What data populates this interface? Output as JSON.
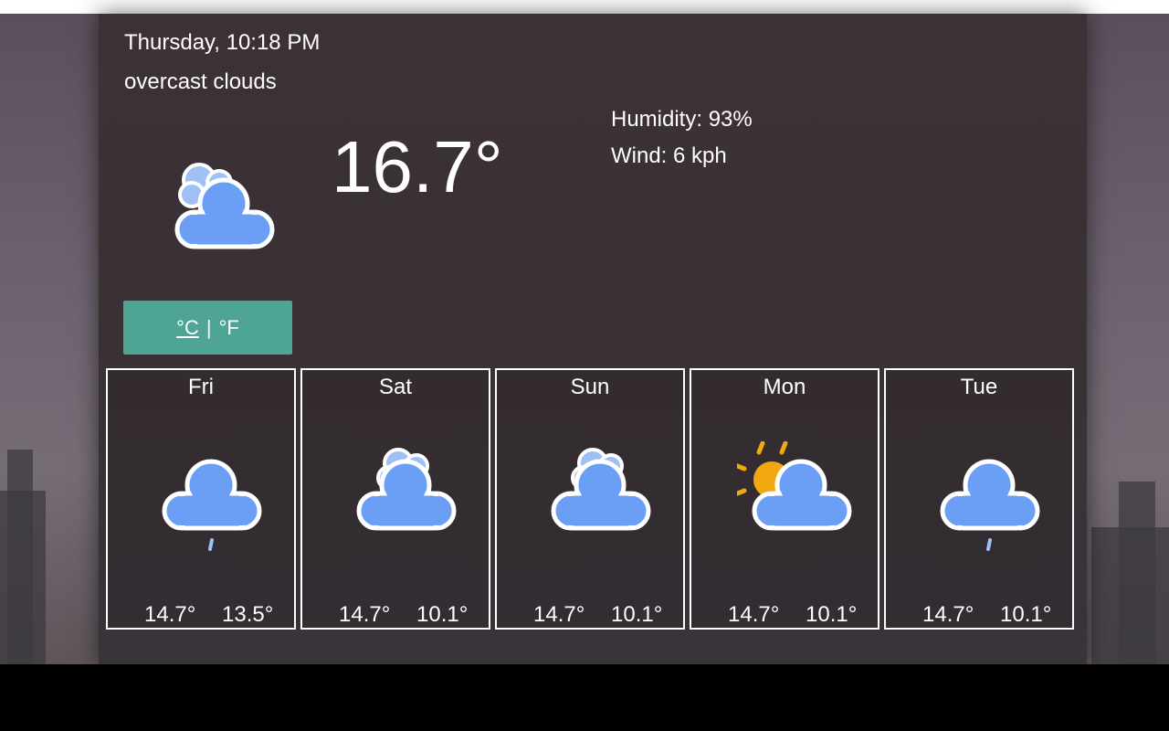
{
  "current": {
    "datetime": "Thursday, 10:18 PM",
    "condition": "overcast clouds",
    "icon": "overcast-clouds-icon",
    "temperature": "16.7°",
    "humidity": "Humidity: 93%",
    "wind": "Wind: 6 kph"
  },
  "unit_toggle": {
    "celsius": "°C",
    "separator": "|",
    "fahrenheit": "°F"
  },
  "forecast": [
    {
      "day": "Fri",
      "icon": "light-rain-icon",
      "high": "14.7°",
      "low": "13.5°"
    },
    {
      "day": "Sat",
      "icon": "overcast-clouds-icon",
      "high": "14.7°",
      "low": "10.1°"
    },
    {
      "day": "Sun",
      "icon": "overcast-clouds-icon",
      "high": "14.7°",
      "low": "10.1°"
    },
    {
      "day": "Mon",
      "icon": "partly-cloudy-icon",
      "high": "14.7°",
      "low": "10.1°"
    },
    {
      "day": "Tue",
      "icon": "light-rain-icon",
      "high": "14.7°",
      "low": "10.1°"
    }
  ],
  "colors": {
    "cloud": "#6a9ff5",
    "cloud_back": "#9ec0f5",
    "sun": "#f2a911",
    "rain": "#9ec0f5",
    "toggle": "#4ea596"
  }
}
